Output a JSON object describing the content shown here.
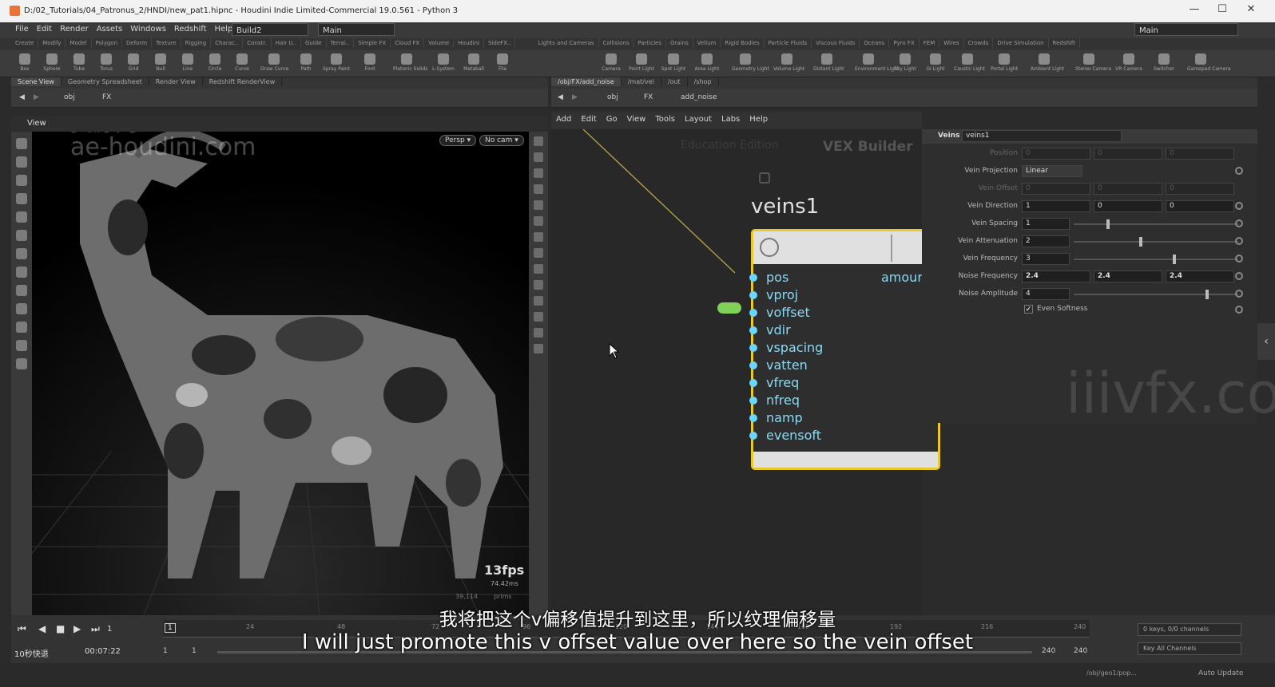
{
  "window": {
    "title": "D:/02_Tutorials/04_Patronus_2/HNDI/new_pat1.hipnc - Houdini Indie Limited-Commercial 19.0.561 - Python 3",
    "min": "—",
    "max": "☐",
    "close": "✕"
  },
  "menu": [
    "File",
    "Edit",
    "Render",
    "Assets",
    "Windows",
    "Redshift",
    "Help"
  ],
  "desktop": {
    "build": "Build2",
    "main": "Main",
    "right_main": "Main"
  },
  "shelf_tabs_left": [
    "Create",
    "Modify",
    "Model",
    "Polygon",
    "Deform",
    "Texture",
    "Rigging",
    "Charac..",
    "Constr.",
    "Hair U..",
    "Guide",
    "Terrai..",
    "Simple FX",
    "Cloud FX",
    "Volume",
    "Houdini",
    "SideFX.."
  ],
  "shelf_tabs_right": [
    "Lights and Cameras",
    "Collisions",
    "Particles",
    "Grains",
    "Vellum",
    "Rigid Bodies",
    "Particle Fluids",
    "Viscous Fluids",
    "Oceans",
    "Pyro FX",
    "FEM",
    "Wires",
    "Crowds",
    "Drive Simulation",
    "Redshift"
  ],
  "tools_left": [
    "Box",
    "Sphere",
    "Tube",
    "Torus",
    "Grid",
    "Null",
    "Line",
    "Circle",
    "Curve",
    "Draw Curve",
    "Path",
    "Spray Paint",
    "Font",
    "Platonic Solids",
    "L-System",
    "Metaball",
    "File"
  ],
  "tools_right": [
    "Camera",
    "Point Light",
    "Spot Light",
    "Area Light",
    "Geometry Light",
    "Volume Light",
    "Distant Light",
    "Environment Light",
    "Sky Light",
    "GI Light",
    "Caustic Light",
    "Portal Light",
    "Ambient Light",
    "Stereo Camera",
    "VR Camera",
    "Switcher",
    "Gamepad Camera"
  ],
  "left_panes": [
    "Scene View",
    "Geometry Spreadsheet",
    "Render View",
    "Redshift RenderView"
  ],
  "left_path": {
    "obj": "obj",
    "fx": "FX"
  },
  "right_panes": [
    "/obj/FX/add_noise",
    "/mat/vel",
    "/out",
    "/shop"
  ],
  "right_path": {
    "obj": "obj",
    "fx": "FX",
    "node": "add_noise"
  },
  "viewport": {
    "label": "View",
    "persp": "Persp ▾",
    "cam": "No cam ▾",
    "fps": "13fps",
    "ms": "74.42ms",
    "prims_label": "prims",
    "prims_value": "39,114"
  },
  "watermarks": {
    "w1": "资源网",
    "w2": "ae-houdini.com",
    "w3": "iiivfx.com"
  },
  "network": {
    "menu": [
      "Add",
      "Edit",
      "Go",
      "View",
      "Tools",
      "Layout",
      "Labs",
      "Help"
    ],
    "edu": "Education Edition",
    "builder": "VEX Builder"
  },
  "node": {
    "name": "veins1",
    "inputs": [
      "pos",
      "vproj",
      "voffset",
      "vdir",
      "vspacing",
      "vatten",
      "vfreq",
      "nfreq",
      "namp",
      "evensoft"
    ],
    "output": "amoun"
  },
  "params": {
    "type": "Veins",
    "name": "veins1",
    "position": {
      "label": "Position",
      "v": [
        "0",
        "0",
        "0"
      ]
    },
    "projection": {
      "label": "Vein Projection",
      "value": "Linear"
    },
    "offset": {
      "label": "Vein Offset",
      "v": [
        "0",
        "0",
        "0"
      ]
    },
    "direction": {
      "label": "Vein Direction",
      "v": [
        "1",
        "0",
        "0"
      ]
    },
    "spacing": {
      "label": "Vein Spacing",
      "value": "1",
      "level": 0.2
    },
    "attenuation": {
      "label": "Vein Attenuation",
      "value": "2",
      "level": 0.4
    },
    "frequency": {
      "label": "Vein Frequency",
      "value": "3",
      "level": 0.6
    },
    "noise_freq": {
      "label": "Noise Frequency",
      "v": [
        "2.4",
        "2.4",
        "2.4"
      ]
    },
    "noise_amp": {
      "label": "Noise Amplitude",
      "value": "4",
      "level": 0.8
    },
    "even": {
      "label": "Even Softness",
      "check": "✓"
    }
  },
  "timeline": {
    "frame": "1",
    "start": "1",
    "end_a": "1",
    "range_end": "240",
    "range_end2": "240",
    "ticks": [
      "24",
      "48",
      "72",
      "96",
      "120",
      "144",
      "168",
      "192",
      "216",
      "240"
    ],
    "keys": "0 keys, 0/0 channels",
    "key_all": "Key All Channels",
    "time": "00:07:22",
    "speed": "10秒快退"
  },
  "status": {
    "path": "/obj/geo1/pop...",
    "update": "Auto Update"
  },
  "subtitles": {
    "zh": "我将把这个v偏移值提升到这里，所以纹理偏移量",
    "en": "I will just promote this v offset value over here so the vein offset"
  }
}
